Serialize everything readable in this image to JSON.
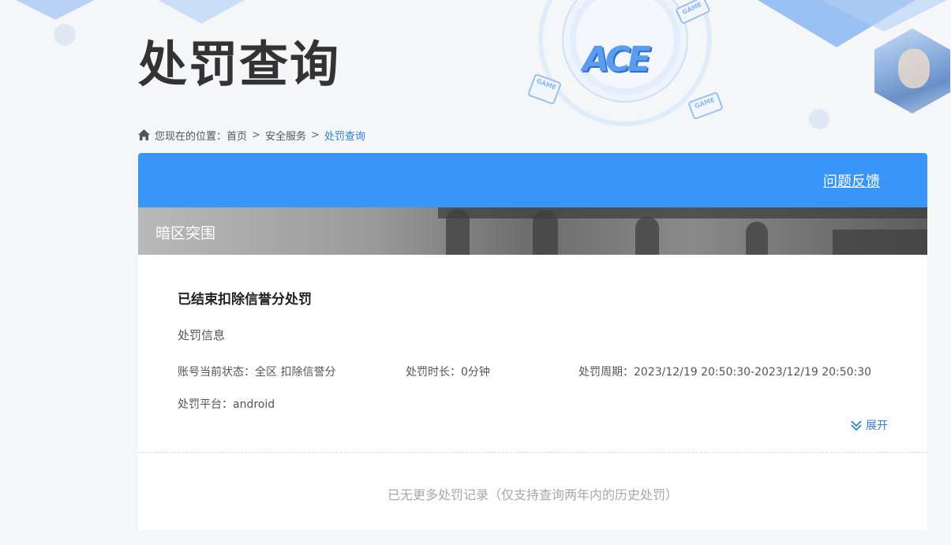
{
  "header": {
    "title": "处罚查询"
  },
  "breadcrumb": {
    "prefix": "您现在的位置：",
    "items": [
      "首页",
      "安全服务",
      "处罚查询"
    ],
    "separator": ">"
  },
  "card": {
    "feedback_label": "问题反馈",
    "game_name": "暗区突围",
    "record": {
      "title": "已结束扣除信誉分处罚",
      "section_label": "处罚信息",
      "status_label": "账号当前状态：",
      "status_value": "全区 扣除信誉分",
      "duration_label": "处罚时长：",
      "duration_value": "0分钟",
      "period_label": "处罚周期：",
      "period_value": "2023/12/19 20:50:30-2023/12/19 20:50:30",
      "platform_label": "处罚平台：",
      "platform_value": "android",
      "expand_label": "展开"
    },
    "no_more_text": "已无更多处罚记录（仅支持查询两年内的历史处罚）"
  },
  "logo": {
    "text": "ACE"
  },
  "decor": {
    "game_tag": "GAME"
  },
  "colors": {
    "accent": "#3a95f9",
    "link": "#2f7fd1"
  }
}
